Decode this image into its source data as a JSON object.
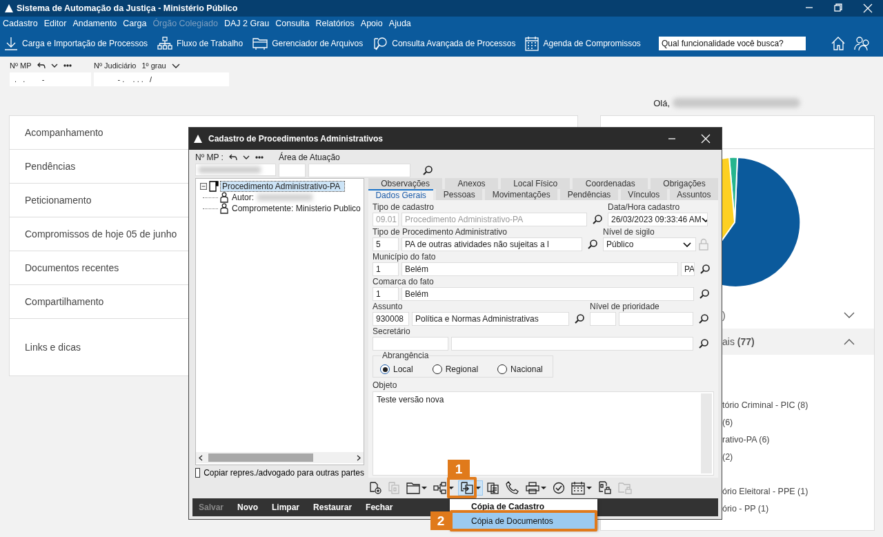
{
  "window": {
    "title": "Sistema de Automação da Justiça - Ministério Público"
  },
  "menu": [
    {
      "label": "Cadastro",
      "disabled": false
    },
    {
      "label": "Editor",
      "disabled": false
    },
    {
      "label": "Andamento",
      "disabled": false
    },
    {
      "label": "Carga",
      "disabled": false
    },
    {
      "label": "Órgão Colegiado",
      "disabled": true
    },
    {
      "label": "DAJ 2 Grau",
      "disabled": false
    },
    {
      "label": "Consulta",
      "disabled": false
    },
    {
      "label": "Relatórios",
      "disabled": false
    },
    {
      "label": "Apoio",
      "disabled": false
    },
    {
      "label": "Ajuda",
      "disabled": false
    }
  ],
  "toolbar": [
    {
      "label": "Carga e Importação de Processos",
      "kind": "download"
    },
    {
      "label": "Fluxo de Trabalho",
      "kind": "hierarchy"
    },
    {
      "label": "Gerenciador de Arquivos",
      "kind": "folder"
    },
    {
      "label": "Consulta Avançada de Processos",
      "kind": "search"
    },
    {
      "label": "Agenda de Compromissos",
      "kind": "calendar"
    }
  ],
  "search": {
    "placeholder": "Qual funcionalidade você busca?"
  },
  "process_fields": {
    "mp_label": "Nº MP",
    "mp_value": " .   .        -",
    "judicial_label": "Nº Judiciário",
    "grade": "1º grau",
    "judicial_value": "          - .    . . .   /"
  },
  "greeting": "Olá,",
  "sections": [
    {
      "label": "Acompanhamento"
    },
    {
      "label": "Pendências"
    },
    {
      "label": "Peticionamento"
    },
    {
      "label": "Compromissos de hoje 05 de junho"
    },
    {
      "label": "Documentos recentes"
    },
    {
      "label": "Compartilhamento"
    },
    {
      "label": "Links e dicas"
    }
  ],
  "right_panel": {
    "rows": [
      {
        "label": ")",
        "expanded": false
      },
      {
        "label": "ais **(77)**",
        "expanded": true
      }
    ],
    "groups": [
      [
        "tório Criminal - PIC (8)",
        "(6)",
        "rativo-PA (6)",
        "(2)"
      ],
      [
        "ório Eleitoral - PPE (1)",
        "ório - PP (1)"
      ]
    ]
  },
  "dialog": {
    "title": "Cadastro de Procedimentos Administrativos",
    "mp_label": "Nº MP :",
    "area_label": "Área de Atuação",
    "tree": {
      "label": "Procedimento Administrativo-PA",
      "selected": true,
      "expanded": true,
      "children": [
        {
          "label": "Autor:"
        },
        {
          "label": "Comprometente: Ministerio Publico"
        }
      ]
    },
    "copy_checkbox": {
      "label": "Copiar repres./advogado para outras partes",
      "checked": false
    },
    "tab_rows": [
      [
        {
          "label": "Observações",
          "selected": false
        },
        {
          "label": "Anexos",
          "selected": false
        },
        {
          "label": "Local Físico",
          "selected": false
        },
        {
          "label": "Coordenadas",
          "selected": false
        },
        {
          "label": "Obrigações",
          "selected": false
        }
      ],
      [
        {
          "label": "Dados Gerais",
          "selected": true
        },
        {
          "label": "Pessoas",
          "selected": false
        },
        {
          "label": "Movimentações",
          "selected": false
        },
        {
          "label": "Pendências",
          "selected": false
        },
        {
          "label": "Vínculos",
          "selected": false
        },
        {
          "label": "Assuntos",
          "selected": false
        }
      ]
    ],
    "form": {
      "tipo_cadastro": {
        "label": "Tipo de cadastro",
        "code": "09.01",
        "value": "Procedimento Administrativo-PA",
        "disabled": true
      },
      "data_hora": {
        "label": "Data/Hora cadastro",
        "value": "26/03/2023 09:33:46 AM"
      },
      "tipo_procedimento": {
        "label": "Tipo de Procedimento Administrativo",
        "code": "5",
        "value": "PA de outras atividades não sujeitas a l"
      },
      "nivel_sigilo": {
        "label": "Nível de sigilo",
        "value": "Público"
      },
      "municipio": {
        "label": "Município do fato",
        "code": "1",
        "value": "Belém",
        "uf": "PA"
      },
      "comarca": {
        "label": "Comarca do fato",
        "code": "1",
        "value": "Belém"
      },
      "assunto": {
        "label": "Assunto",
        "code": "930008",
        "value": "Política e Normas Administrativas"
      },
      "prioridade": {
        "label": "Nível de prioridade"
      },
      "secretario": {
        "label": "Secretário"
      },
      "abrangencia": {
        "label": "Abrangência",
        "options": [
          {
            "label": "Local",
            "selected": true
          },
          {
            "label": "Regional",
            "selected": false
          },
          {
            "label": "Nacional",
            "selected": false
          }
        ]
      },
      "objeto": {
        "label": "Objeto",
        "value": "Teste versão nova"
      }
    },
    "tools": [
      {
        "kind": "doc-add",
        "disabled": false,
        "dropdown": false,
        "selected": false
      },
      {
        "kind": "doc-copy",
        "disabled": true,
        "dropdown": false,
        "selected": false
      },
      {
        "kind": "folder",
        "disabled": false,
        "dropdown": true,
        "selected": false
      },
      {
        "kind": "hierarchy",
        "disabled": false,
        "dropdown": true,
        "selected": false
      },
      {
        "kind": "transfer",
        "disabled": false,
        "dropdown": true,
        "selected": true
      },
      {
        "kind": "clipboard",
        "disabled": false,
        "dropdown": false,
        "selected": false
      },
      {
        "kind": "phone",
        "disabled": false,
        "dropdown": false,
        "selected": false
      },
      {
        "kind": "printer",
        "disabled": false,
        "dropdown": true,
        "selected": false
      },
      {
        "kind": "check",
        "disabled": false,
        "dropdown": false,
        "selected": false
      },
      {
        "kind": "calendar",
        "disabled": false,
        "dropdown": true,
        "selected": false
      },
      {
        "kind": "doc-lock",
        "disabled": false,
        "dropdown": false,
        "selected": false
      },
      {
        "kind": "folder-lock",
        "disabled": true,
        "dropdown": false,
        "selected": false
      }
    ],
    "actions": [
      {
        "label": "Salvar",
        "disabled": true
      },
      {
        "label": "Novo",
        "disabled": false
      },
      {
        "label": "Limpar",
        "disabled": false
      },
      {
        "label": "Restaurar",
        "disabled": false
      },
      {
        "label": "Fechar",
        "disabled": false
      }
    ],
    "popup_menu": [
      {
        "label": "Cópia de Cadastro",
        "default": true,
        "selected": false
      },
      {
        "label": "Cópia de Documentos",
        "default": false,
        "selected": true
      }
    ]
  },
  "callouts": [
    {
      "label": "1"
    },
    {
      "label": "2"
    }
  ]
}
